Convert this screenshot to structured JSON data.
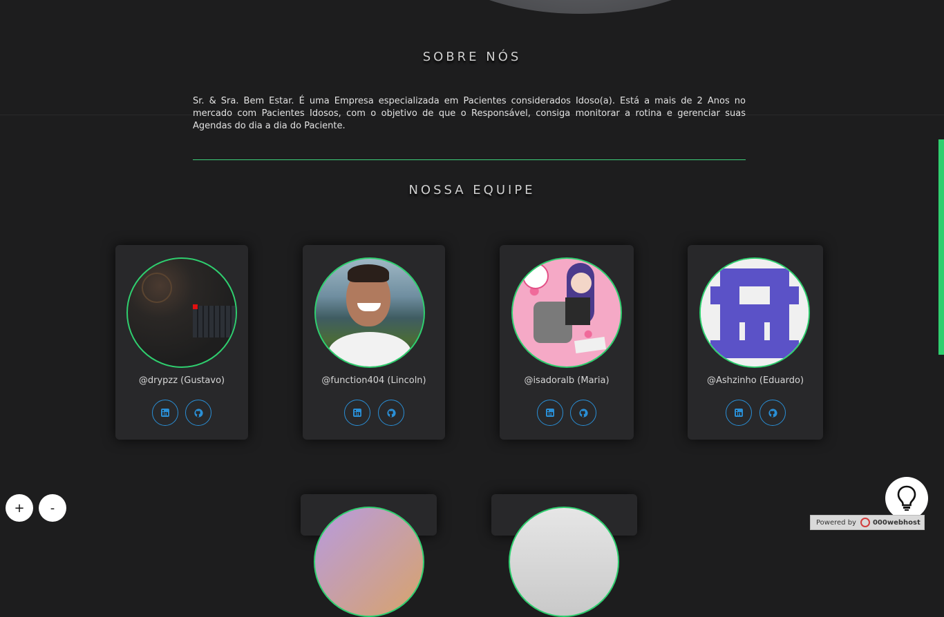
{
  "about": {
    "heading": "SOBRE NÓS",
    "text": "Sr. & Sra. Bem Estar. É uma Empresa especializada em Pacientes considerados Idoso(a). Está a mais de 2 Anos no mercado com Pacientes Idosos, com o objetivo de que o Responsável, consiga monitorar a rotina e gerenciar suas Agendas do dia a dia do Paciente."
  },
  "team": {
    "heading": "NOSSA EQUIPE",
    "members": [
      {
        "name": "@drypzz (Gustavo)"
      },
      {
        "name": "@function404 (Lincoln)"
      },
      {
        "name": "@isadoralb (Maria)"
      },
      {
        "name": "@Ashzinho (Eduardo)"
      }
    ]
  },
  "icons": {
    "social1": "linkedin-icon",
    "social2": "github-icon",
    "help": "lightbulb-icon"
  },
  "controls": {
    "zoom_in": "+",
    "zoom_out": "-"
  },
  "footer": {
    "powered_label": "Powered by",
    "host_name": "000webhost"
  },
  "colors": {
    "accent_green": "#2fcf6f",
    "social_blue": "#2a8fd6",
    "background": "#1d1d1e"
  }
}
